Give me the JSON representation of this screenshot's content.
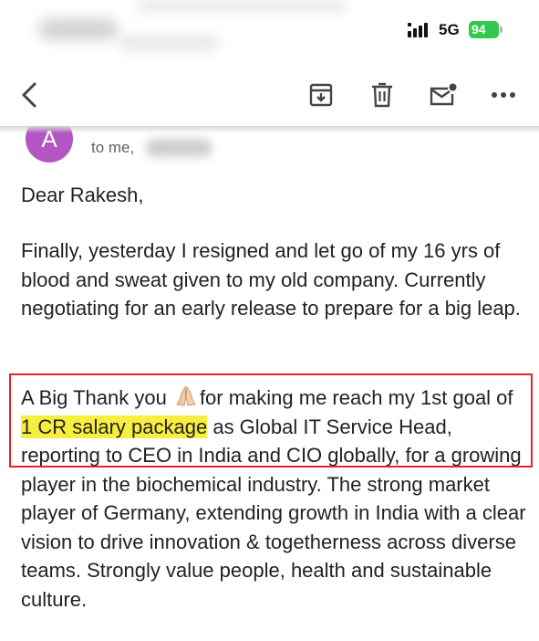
{
  "status_bar": {
    "network": "5G",
    "battery": "94"
  },
  "toolbar": {
    "back_icon": "chevron-left-icon",
    "archive_icon": "archive-icon",
    "delete_icon": "trash-icon",
    "unread_icon": "mail-unread-icon",
    "more_icon": "more-horizontal-icon"
  },
  "sender": {
    "avatar_letter": "A",
    "to_label": "to me,"
  },
  "email": {
    "greeting": "Dear Rakesh,",
    "paragraph1": "Finally, yesterday I resigned and let go of my 16 yrs of blood and sweat given to my old company. Currently negotiating for an early release to prepare for a big leap.",
    "p2_start": "A Big Thank you ",
    "p2_after_emoji": "for making me reach my 1st goal of ",
    "p2_highlight": "1 CR salary package",
    "p2_rest": " as Global IT Service Head, reporting to CEO in India and CIO globally, for a growing player in the biochemical industry. The strong market player of Germany, extending growth in India with a clear vision to drive innovation & togetherness across diverse teams. Strongly value people, health and sustainable culture."
  },
  "colors": {
    "highlight": "#f7ee3d",
    "annotation_box": "#e6212b",
    "avatar": "#b455c4",
    "battery": "#30c94a"
  }
}
